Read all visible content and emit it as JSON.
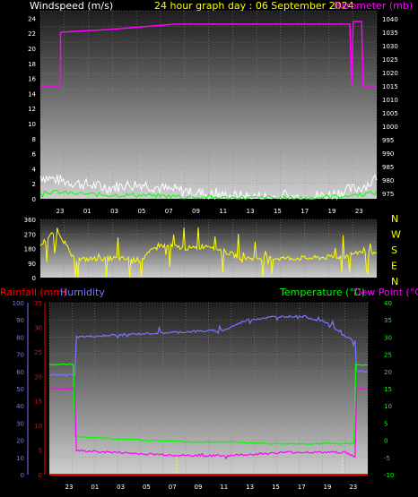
{
  "header": {
    "windspeed_label": "Windspeed (m/s)",
    "title": "24 hour graph day : 06 September 2024",
    "barometer_label": "Barometer (mb)"
  },
  "colors": {
    "background": "#000000",
    "panel_top": "#1e1e1e",
    "panel_bottom": "#c8c8c8",
    "grid": "#8a8a8a",
    "axis_text": "#ffffff",
    "title": "#ffff00",
    "barometer": "#ff00ff",
    "windspeed": "#ffffff",
    "gust_green": "#00ff00",
    "direction": "#ffff00",
    "rainfall": "#ff0000",
    "humidity": "#7777ff",
    "temperature": "#00ff00",
    "dewpoint": "#ff00ff",
    "hour_marker": "#ffff00"
  },
  "chart_data": [
    {
      "type": "line",
      "name": "wind-barometer",
      "x_tick_labels": [
        "23",
        "01",
        "03",
        "05",
        "07",
        "09",
        "11",
        "13",
        "15",
        "17",
        "19",
        "23"
      ],
      "left_axis": {
        "label": "Windspeed (m/s)",
        "ticks": [
          "0",
          "2",
          "4",
          "6",
          "8",
          "10",
          "12",
          "14",
          "16",
          "18",
          "20",
          "22",
          "24"
        ],
        "ylim": [
          0,
          25
        ]
      },
      "right_axis": {
        "label": "Barometer (mb)",
        "ticks": [
          "975",
          "980",
          "985",
          "990",
          "995",
          "1000",
          "1005",
          "1010",
          "1015",
          "1020",
          "1025",
          "1030",
          "1035",
          "1040"
        ],
        "ylim": [
          973,
          1043
        ]
      },
      "grid": true,
      "series": [
        {
          "name": "Barometer (mb)",
          "axis": "right",
          "color": "#ff00ff",
          "x": [
            0,
            0.06,
            0.06,
            0.2,
            0.4,
            0.6,
            0.8,
            0.92,
            0.925,
            0.93,
            0.955,
            0.96,
            1.0
          ],
          "y": [
            1015,
            1015,
            1035,
            1036,
            1038,
            1038,
            1038,
            1038,
            1015,
            1039,
            1039,
            1015,
            1015
          ]
        },
        {
          "name": "Windspeed",
          "axis": "left",
          "color": "#ffffff",
          "pattern": "noisy",
          "x": [
            0,
            0.05,
            0.12,
            0.2,
            0.3,
            0.38,
            0.45,
            0.5,
            0.6,
            0.7,
            0.8,
            0.86,
            0.9,
            0.95,
            1.0
          ],
          "y": [
            3,
            2.5,
            2,
            1.5,
            2,
            1.2,
            1,
            0.5,
            0.3,
            0.2,
            0.2,
            0.5,
            1,
            1.5,
            2.5
          ]
        },
        {
          "name": "Gust",
          "axis": "left",
          "color": "#00ff00",
          "pattern": "noisy",
          "x": [
            0,
            0.1,
            0.2,
            0.3,
            0.4,
            0.5,
            0.6,
            0.7,
            0.8,
            0.9,
            1.0
          ],
          "y": [
            1,
            0.7,
            0.5,
            0.5,
            0.3,
            0.2,
            0.1,
            0.1,
            0.1,
            0.4,
            0.8
          ]
        }
      ]
    },
    {
      "type": "line",
      "name": "wind-direction",
      "x_tick_labels": [],
      "left_axis": {
        "ticks": [
          "0",
          "90",
          "180",
          "270",
          "360"
        ],
        "ylim": [
          0,
          360
        ]
      },
      "right_axis": {
        "ticks": [
          "N",
          "E",
          "S",
          "W",
          "N"
        ]
      },
      "grid": true,
      "series": [
        {
          "name": "Direction",
          "axis": "left",
          "color": "#ffff00",
          "pattern": "noisy",
          "x": [
            0,
            0.05,
            0.1,
            0.2,
            0.3,
            0.35,
            0.45,
            0.5,
            0.6,
            0.7,
            0.8,
            0.9,
            0.95,
            1.0
          ],
          "y": [
            200,
            300,
            110,
            120,
            110,
            200,
            180,
            200,
            120,
            120,
            120,
            130,
            160,
            140
          ]
        }
      ]
    },
    {
      "type": "line",
      "name": "temp-humidity",
      "labels": {
        "rainfall": "Rainfall (mm)",
        "humidity": "Humidity",
        "temperature": "Temperature (°C)",
        "dewpoint": "Dew Point (°C)"
      },
      "x_tick_labels": [
        "23",
        "01",
        "03",
        "05",
        "07",
        "09",
        "11",
        "13",
        "15",
        "17",
        "19",
        "23"
      ],
      "humidity_axis": {
        "ticks": [
          "0",
          "10",
          "20",
          "30",
          "40",
          "50",
          "60",
          "70",
          "80",
          "90",
          "100"
        ],
        "ylim": [
          0,
          100
        ]
      },
      "rain_axis": {
        "ticks": [
          "0",
          "5",
          "10",
          "15",
          "20",
          "25",
          "30",
          "35"
        ],
        "ylim": [
          0,
          35
        ]
      },
      "temp_axis": {
        "ticks": [
          "-10",
          "-5",
          "0",
          "5",
          "10",
          "15",
          "20",
          "25",
          "30",
          "35",
          "40"
        ],
        "ylim": [
          -10,
          40
        ]
      },
      "grid": true,
      "hour_markers_x": [
        0.4,
        0.92
      ],
      "series": [
        {
          "name": "Humidity",
          "axis": "humidity",
          "color": "#7777ff",
          "x": [
            0,
            0.08,
            0.08,
            0.3,
            0.55,
            0.62,
            0.72,
            0.8,
            0.88,
            0.93,
            0.96,
            0.96,
            1.0
          ],
          "y": [
            58,
            58,
            80,
            82,
            84,
            90,
            92,
            92,
            88,
            80,
            78,
            60,
            60
          ]
        },
        {
          "name": "Temperature",
          "axis": "temp",
          "color": "#00ff00",
          "x": [
            0,
            0.08,
            0.08,
            0.2,
            0.3,
            0.45,
            0.55,
            0.7,
            0.8,
            0.92,
            0.96,
            0.96,
            1.0
          ],
          "y": [
            22,
            22,
            1,
            0.5,
            0,
            -0.5,
            -0.5,
            -1,
            -1,
            -1,
            -1,
            22,
            22
          ]
        },
        {
          "name": "Dew Point",
          "axis": "temp",
          "color": "#ff00ff",
          "x": [
            0,
            0.08,
            0.08,
            0.2,
            0.3,
            0.45,
            0.55,
            0.65,
            0.75,
            0.85,
            0.93,
            0.96,
            0.96,
            1.0
          ],
          "y": [
            15,
            15,
            -3,
            -3.5,
            -4,
            -4.5,
            -4.5,
            -4,
            -3.5,
            -3.5,
            -3.5,
            -5,
            15,
            15
          ]
        },
        {
          "name": "Rainfall",
          "axis": "rain",
          "color": "#ff0000",
          "x": [
            0,
            1.0
          ],
          "y": [
            0,
            0
          ]
        }
      ]
    }
  ]
}
